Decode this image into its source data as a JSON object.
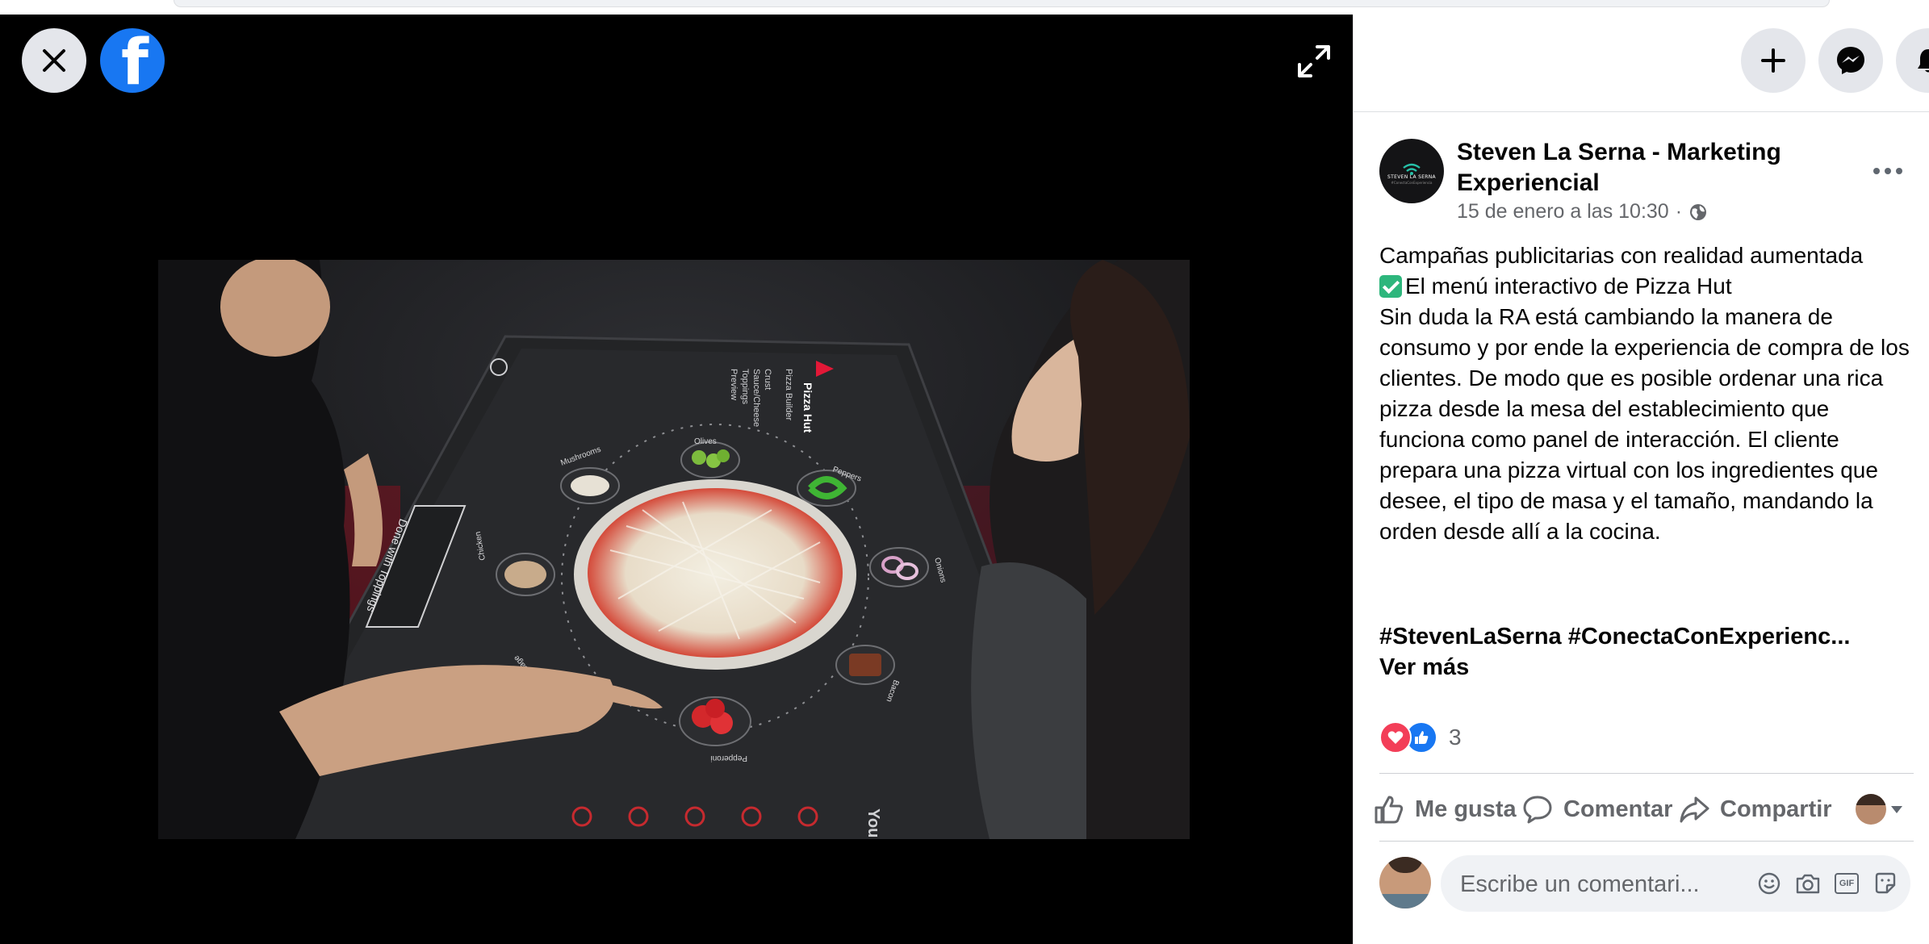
{
  "post": {
    "author": "Steven La Serna - Marketing Experiencial",
    "avatar_text": "STEVEN LA SERNA",
    "avatar_subtext": "#ConectaConExperiencia",
    "timestamp": "15 de enero a las 10:30",
    "separator": "·",
    "privacy_icon": "globe-icon",
    "paragraphs": [
      "Campañas publicitarias con realidad aumentada",
      "El menú interactivo de Pizza Hut",
      "Sin duda la RA está cambiando la manera de consumo y por ende la experiencia de compra de los clientes. De modo que es posible ordenar una rica pizza desde la mesa del establecimiento que funciona como panel de interacción. El cliente prepara una pizza virtual con los ingredientes que desee, el tipo de masa y el tamaño, mandando la orden desde allí a la cocina."
    ],
    "hashtags": "#StevenLaSerna #ConectaConExperienc...",
    "see_more": "Ver más"
  },
  "reactions": {
    "types": [
      "love",
      "like"
    ],
    "count": "3"
  },
  "actions": {
    "like": "Me gusta",
    "comment": "Comentar",
    "share": "Compartir"
  },
  "comment": {
    "placeholder": "Escribe un comentari..."
  },
  "video": {
    "brand": "Pizza Hut",
    "menu_title": "Pizza Builder",
    "menu_items": [
      "Crust",
      "Sauce/Cheese",
      "Toppings",
      "Preview"
    ],
    "done_button": "Done with Toppings",
    "toppings": [
      "Mushrooms",
      "Olives",
      "Peppers",
      "Onions",
      "Bacon",
      "Pepperoni",
      "Sausage",
      "Chicken"
    ],
    "edge_text": "You"
  },
  "colors": {
    "facebook_blue": "#1877f2",
    "love_red": "#f33e58",
    "text_primary": "#050505",
    "text_secondary": "#65676b",
    "button_bg": "#e4e6eb",
    "pizza_hut_red": "#e31837"
  }
}
